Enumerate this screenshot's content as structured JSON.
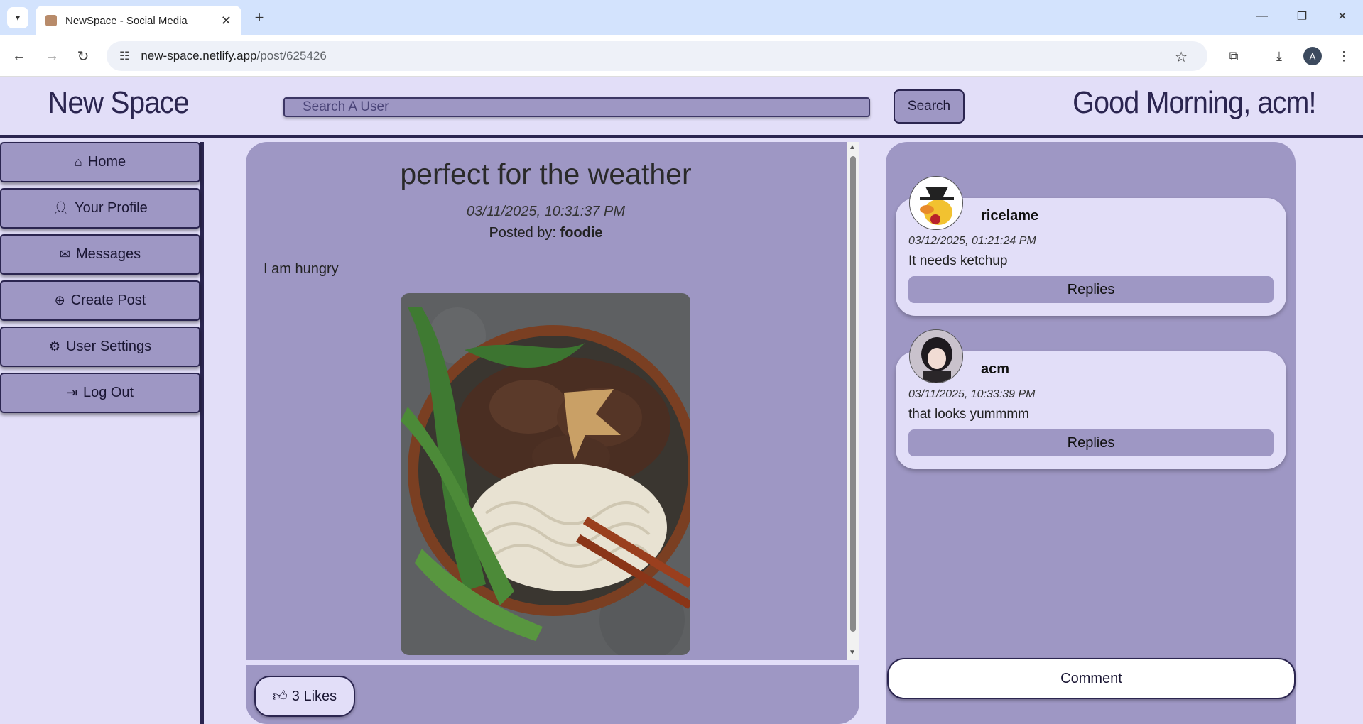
{
  "browser": {
    "tab_title": "NewSpace - Social Media",
    "url_host": "new-space.netlify.app",
    "url_path": "/post/625426",
    "profile_initial": "A"
  },
  "header": {
    "brand": "New Space",
    "search_placeholder": "Search A User",
    "search_label": "Search",
    "greeting": "Good Morning, acm!"
  },
  "sidebar": {
    "items": [
      {
        "label": "Home",
        "icon": "home-icon"
      },
      {
        "label": "Your Profile",
        "icon": "user-icon"
      },
      {
        "label": "Messages",
        "icon": "mail-icon"
      },
      {
        "label": "Create Post",
        "icon": "plus-circle-icon"
      },
      {
        "label": "User Settings",
        "icon": "gear-icon"
      },
      {
        "label": "Log Out",
        "icon": "logout-icon"
      }
    ]
  },
  "post": {
    "title": "perfect for the weather",
    "date": "03/11/2025, 10:31:37 PM",
    "posted_by_label": "Posted by: ",
    "author": "foodie",
    "body": "I am hungry",
    "likes_label": "3 Likes"
  },
  "comments": [
    {
      "user": "ricelame",
      "date": "03/12/2025, 01:21:24 PM",
      "text": "It needs ketchup",
      "replies_label": "Replies"
    },
    {
      "user": "acm",
      "date": "03/11/2025, 10:33:39 PM",
      "text": "that looks yummmm",
      "replies_label": "Replies"
    }
  ],
  "comment_button_label": "Comment"
}
